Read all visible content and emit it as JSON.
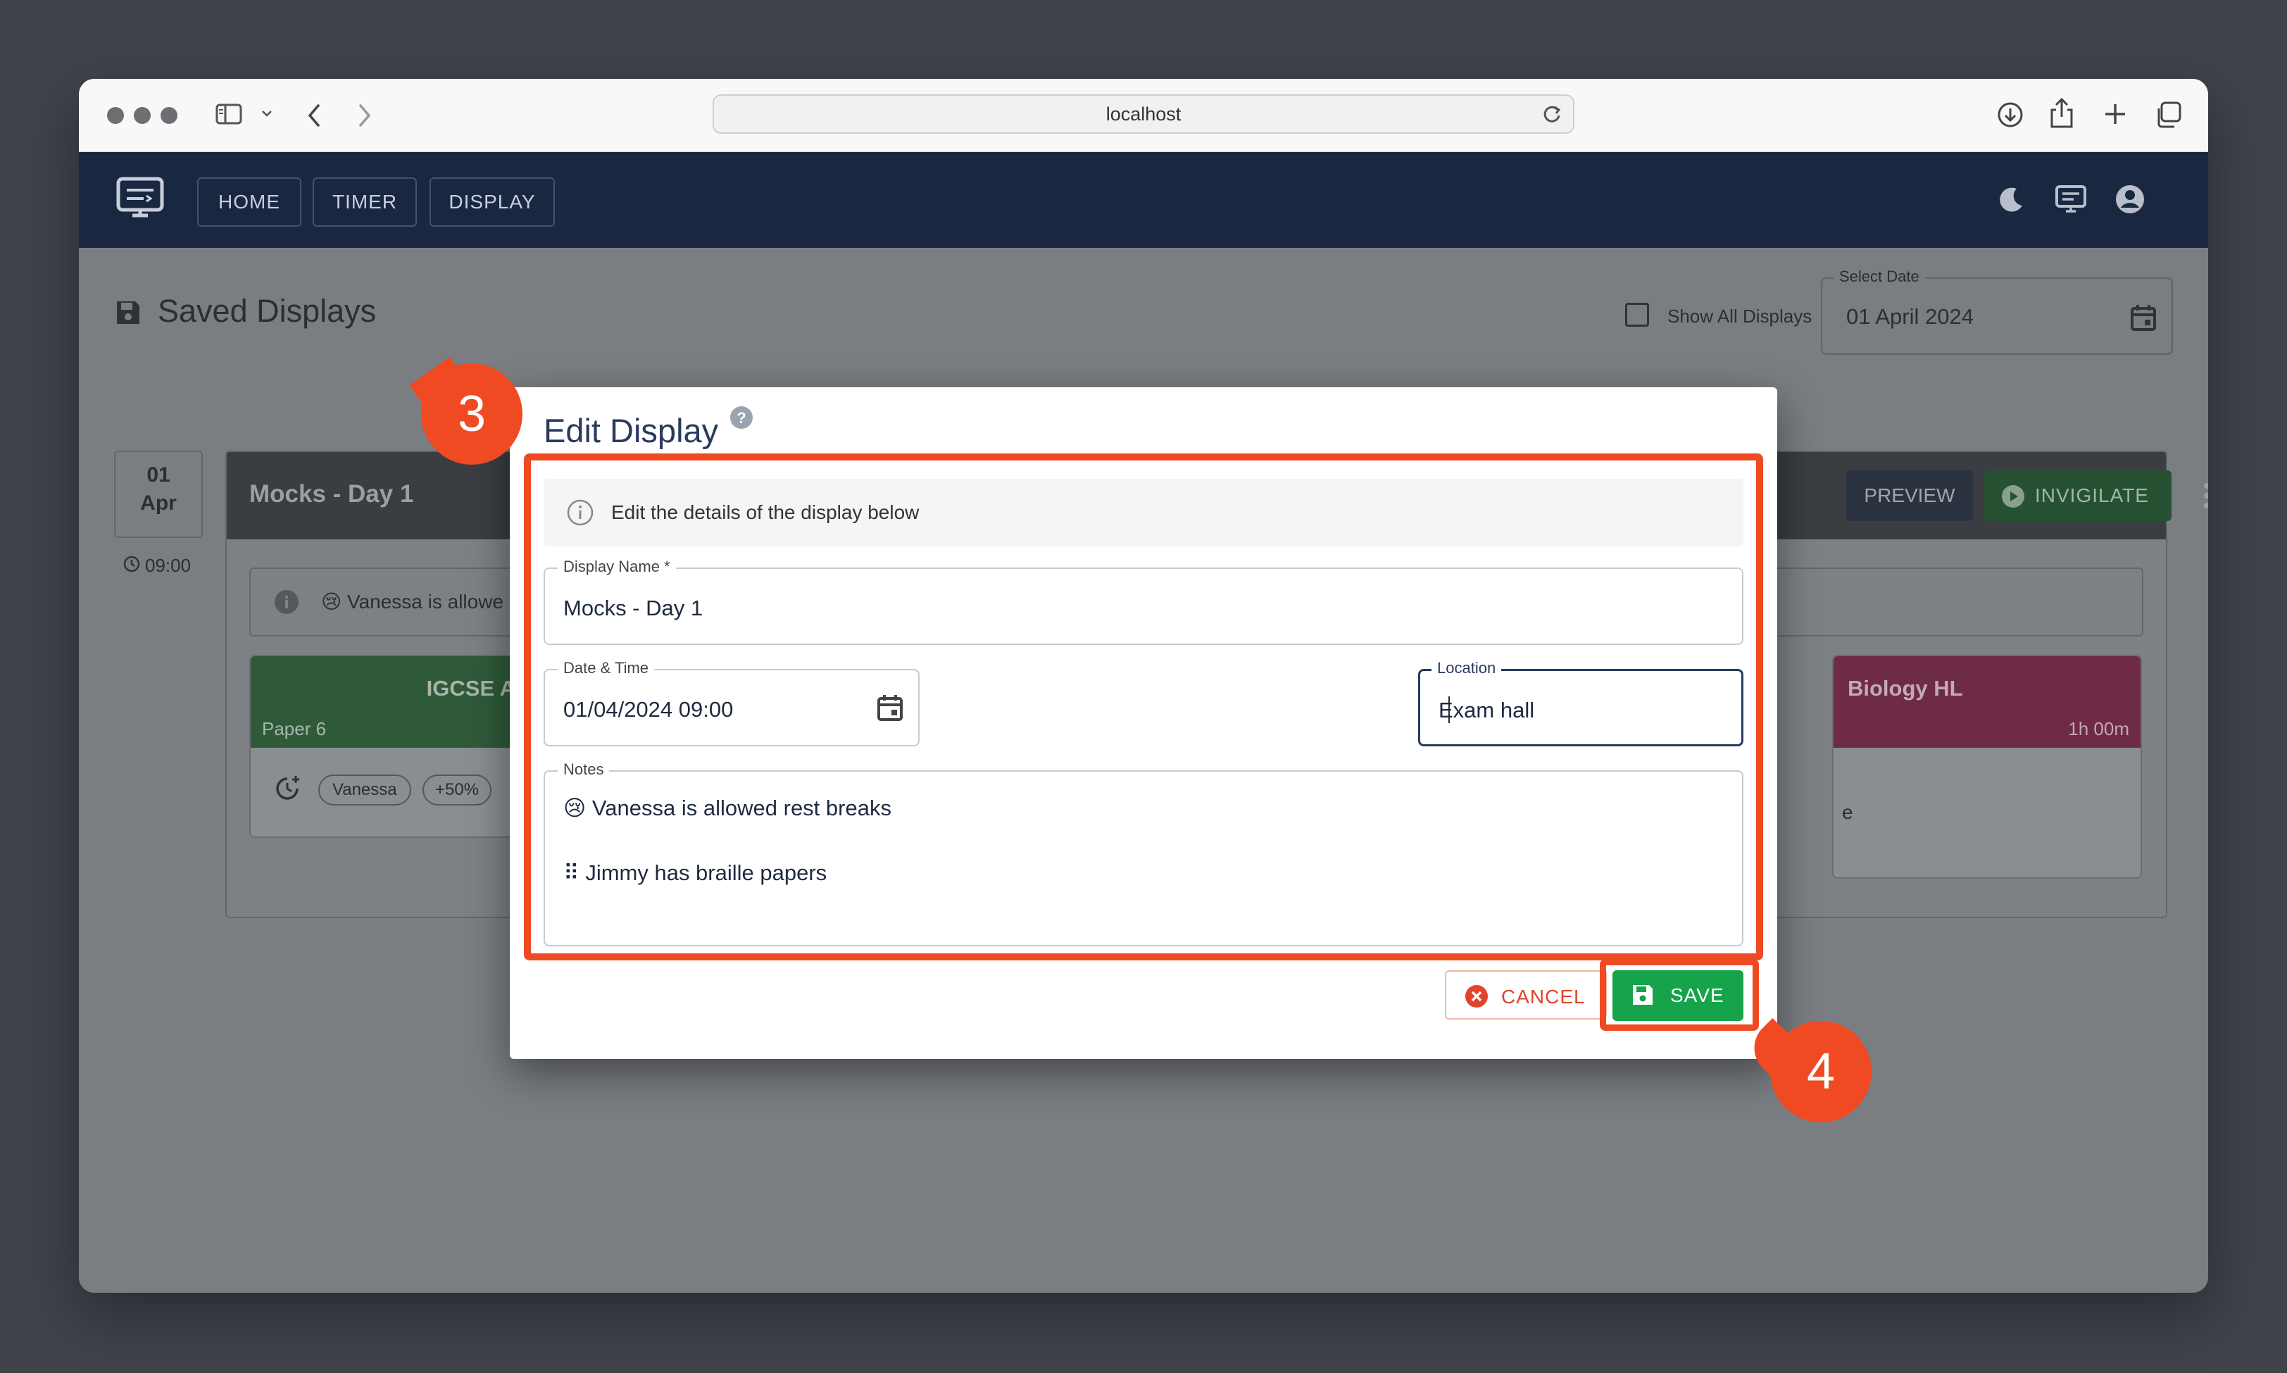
{
  "browser": {
    "url": "localhost"
  },
  "nav": {
    "home": "HOME",
    "timer": "TIMER",
    "display": "DISPLAY"
  },
  "page": {
    "title": "Saved Displays",
    "show_all_label": "Show All Displays",
    "select_date_label": "Select Date",
    "select_date_value": "01 April 2024"
  },
  "background_card": {
    "day": "01",
    "month": "Apr",
    "time": "09:00",
    "name": "Mocks - Day 1",
    "preview": "PREVIEW",
    "invigilate": "INVIGILATE",
    "note_preview": "Vanessa is allowe",
    "exam1": {
      "title": "IGCSE A",
      "paper": "Paper 6",
      "chip_student": "Vanessa",
      "chip_extra": "+50%"
    },
    "exam2": {
      "title": "Biology HL",
      "duration": "1h 00m",
      "fragment": "e"
    }
  },
  "dialog": {
    "title": "Edit Display",
    "info": "Edit the details of the display below",
    "display_name_label": "Display Name *",
    "display_name_value": "Mocks - Day 1",
    "datetime_label": "Date & Time",
    "datetime_value": "01/04/2024 09:00",
    "location_label": "Location",
    "location_value": "Exam hall",
    "notes_label": "Notes",
    "notes": [
      "😢 Vanessa is allowed rest breaks",
      "⠿ Jimmy has braille papers"
    ],
    "cancel": "CANCEL",
    "save": "SAVE"
  },
  "callouts": {
    "step3": "3",
    "step4": "4"
  },
  "colors": {
    "accent_orange": "#f04a23",
    "app_bar": "#1a2741",
    "save_green": "#16a34a",
    "cancel_red": "#e0442a"
  }
}
